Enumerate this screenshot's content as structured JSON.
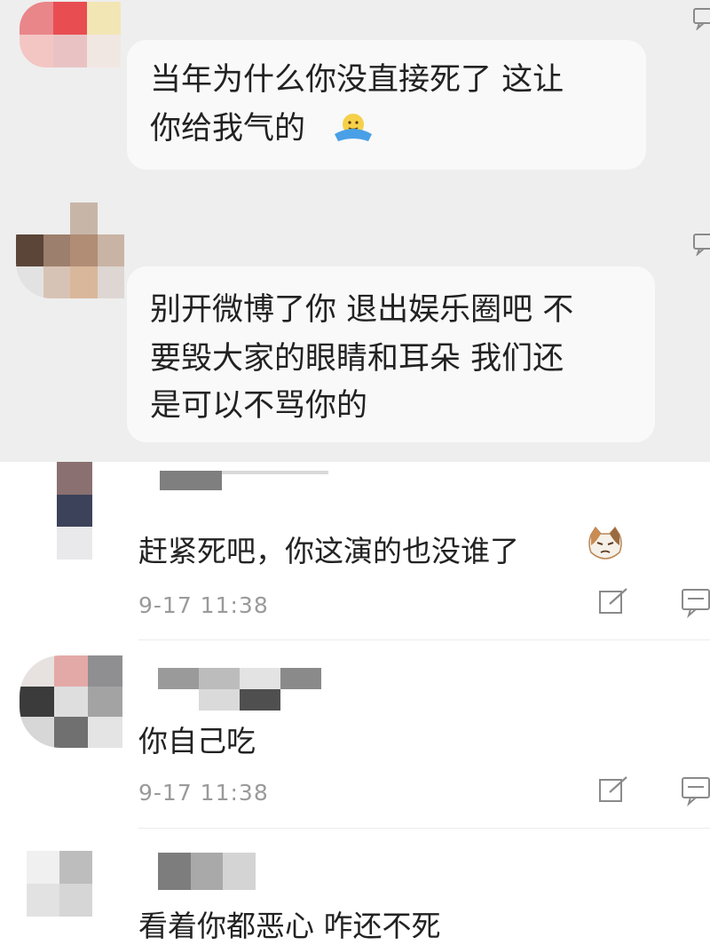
{
  "thread": {
    "messages": [
      {
        "lines": [
          "当年为什么你没直接死了 这让",
          "你给我气的"
        ],
        "emoji": "facepalm-emoji"
      },
      {
        "lines": [
          "别开微博了你 退出娱乐圈吧 不",
          "要毁大家的眼睛和耳朵 我们还",
          "是可以不骂你的"
        ]
      }
    ]
  },
  "comments": [
    {
      "text": "赶紧死吧，你这演的也没谁了",
      "time": "9-17 11:38",
      "emoji": "cat-face-emoji"
    },
    {
      "text": "你自己吃",
      "time": "9-17 11:38"
    },
    {
      "text": "看着你都恶心    咋还不死"
    }
  ],
  "icons": {
    "edit": "edit-icon",
    "reply": "comment-icon"
  },
  "colors": {
    "thread_bg": "#eeeeee",
    "bubble_bg": "#f9f9f9",
    "time_gray": "#9a9a9a"
  }
}
